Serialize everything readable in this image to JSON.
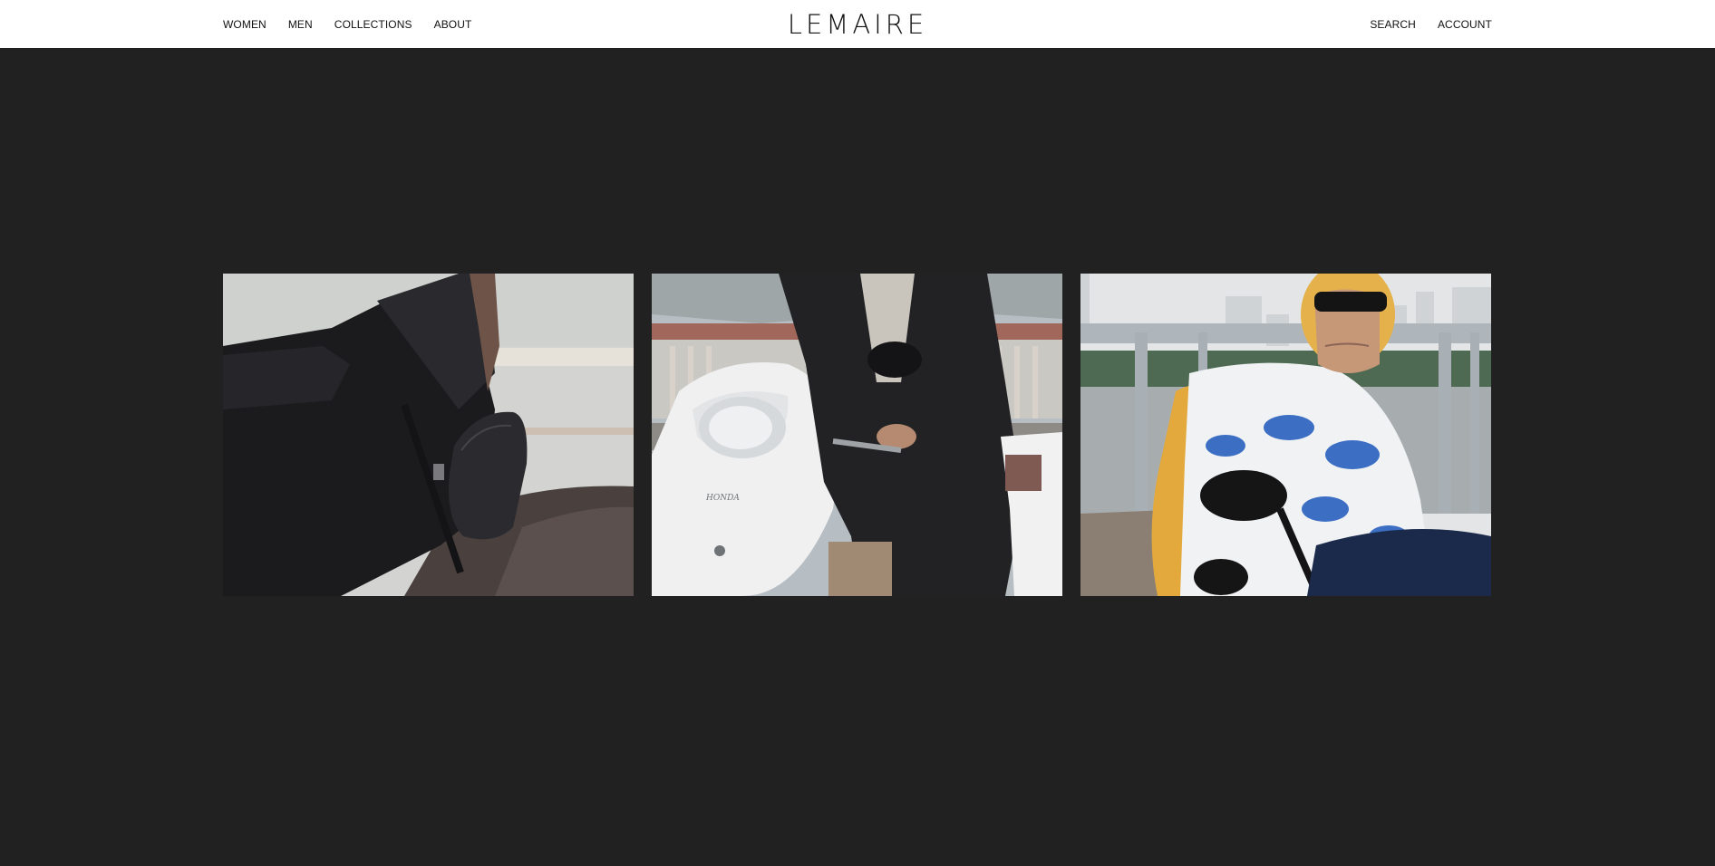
{
  "header": {
    "nav_left": [
      "WOMEN",
      "MEN",
      "COLLECTIONS",
      "ABOUT"
    ],
    "logo": "LEMAIRE",
    "nav_right": [
      "SEARCH",
      "ACCOUNT"
    ]
  },
  "gallery": {
    "images": [
      {
        "subject": "rider-black-jacket-crossbody-bag"
      },
      {
        "subject": "rider-white-scooter-honda"
      },
      {
        "subject": "rider-yellow-helmet-printed-shirt"
      }
    ],
    "scooter_badge": "HONDA"
  },
  "colors": {
    "header_bg": "#ffffff",
    "page_bg": "#212121",
    "text": "#111111"
  }
}
